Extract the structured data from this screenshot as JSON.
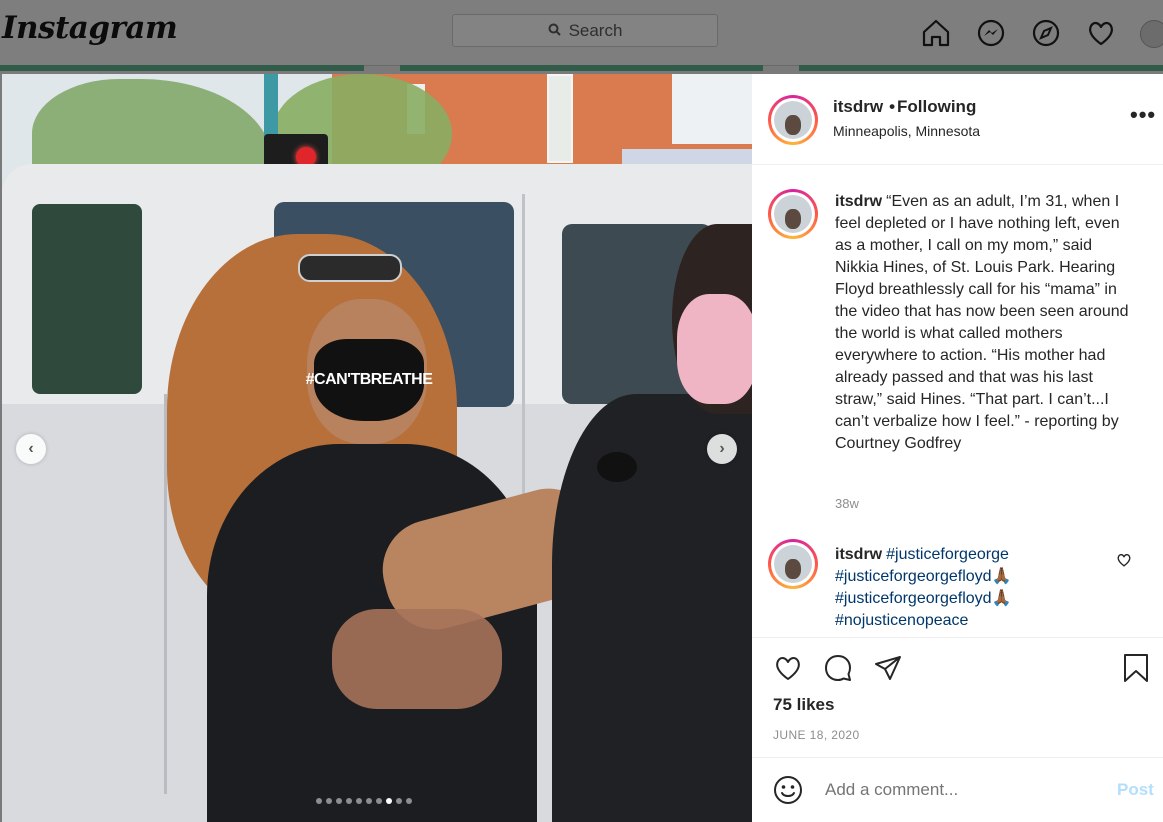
{
  "nav": {
    "logo": "Instagram",
    "search_placeholder": "Search"
  },
  "post": {
    "username": "itsdrw",
    "follow_status": "Following",
    "location": "Minneapolis, Minnesota",
    "mask_text": "#CAN'TBREATHE",
    "caption": "“Even as an adult, I’m 31, when I feel depleted or I have nothing left, even as a mother, I call on my mom,” said Nikkia Hines, of St. Louis Park. Hearing Floyd breathlessly call for his “mama” in the video that has now been seen around the world is what called mothers everywhere to action. “His mother had already passed and that was his last straw,” said Hines. “That part. I can’t...I can’t verbalize how I feel.” - reporting by Courtney Godfrey",
    "caption_age": "38w",
    "comment": {
      "username": "itsdrw",
      "line1": "#justiceforgeorge",
      "line2": "#justiceforgeorgefloyd🙏🏾",
      "line3": "#justiceforgeorgefloyd🙏🏾",
      "line4": "#nojusticenopeace"
    },
    "likes": "75 likes",
    "date": "JUNE 18, 2020",
    "add_comment_placeholder": "Add a comment...",
    "post_button": "Post",
    "carousel": {
      "total": 10,
      "active_index": 7
    }
  }
}
